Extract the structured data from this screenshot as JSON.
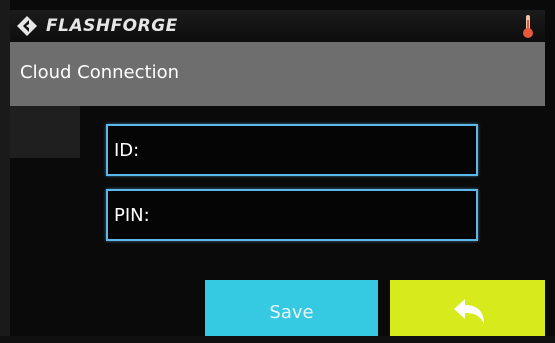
{
  "header": {
    "brand": "FLASHFORGE",
    "logo_icon": "flashforge-logo-icon",
    "temperature_icon": "thermometer-icon",
    "temperature_color": "#e8593b"
  },
  "screen": {
    "title": "Cloud Connection"
  },
  "form": {
    "id_label": "ID:",
    "id_value": "",
    "pin_label": "PIN:",
    "pin_value": ""
  },
  "actions": {
    "save_label": "Save",
    "back_icon": "back-arrow-icon"
  },
  "colors": {
    "field_border": "#5bb8e8",
    "save_button": "#35c9e2",
    "back_button": "#d7ea1c",
    "title_bar": "#6e6e6e"
  }
}
